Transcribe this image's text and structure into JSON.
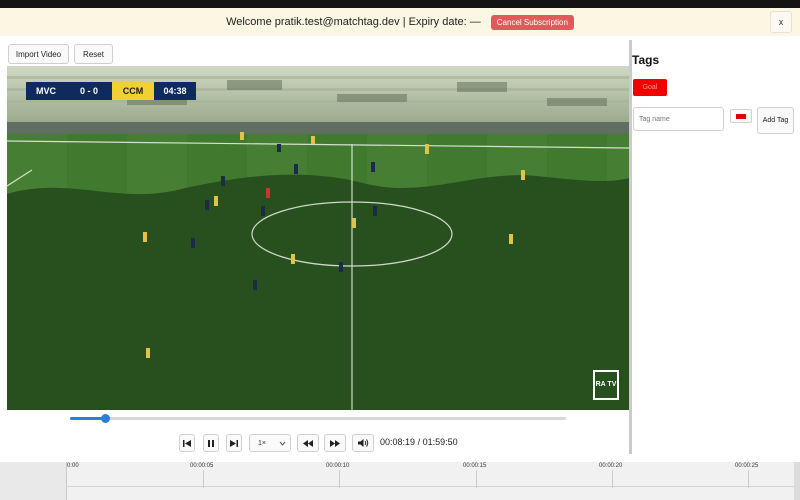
{
  "banner": {
    "welcome_text": "Welcome pratik.test@matchtag.dev | Expiry date: —",
    "cancel_label": "Cancel Subscription",
    "close_symbol": "x"
  },
  "toolbar": {
    "import_label": "Import Video",
    "reset_label": "Reset"
  },
  "video": {
    "score": {
      "home_team": "MVC",
      "score": "0 - 0",
      "away_team": "CCM",
      "clock": "04:38"
    },
    "broadcaster_logo": "RA TV"
  },
  "player": {
    "progress": 0.07,
    "speed_label": "1×",
    "current_time": "00:08:19",
    "separator": "/",
    "duration": "01:59:50"
  },
  "tags": {
    "title": "Tags",
    "existing": [
      {
        "label": "Goal",
        "color": "#f00000"
      }
    ],
    "name_placeholder": "Tag name",
    "selected_color": "#e00000",
    "add_label": "Add Tag"
  },
  "timeline": {
    "ticks": [
      "0:00",
      "00:00:05",
      "00:00:10",
      "00:00:15",
      "00:00:20",
      "00:00:25"
    ]
  },
  "colors": {
    "accent": "#2d7be6",
    "danger": "#e05a5a",
    "banner_bg": "#fcf7e3"
  }
}
